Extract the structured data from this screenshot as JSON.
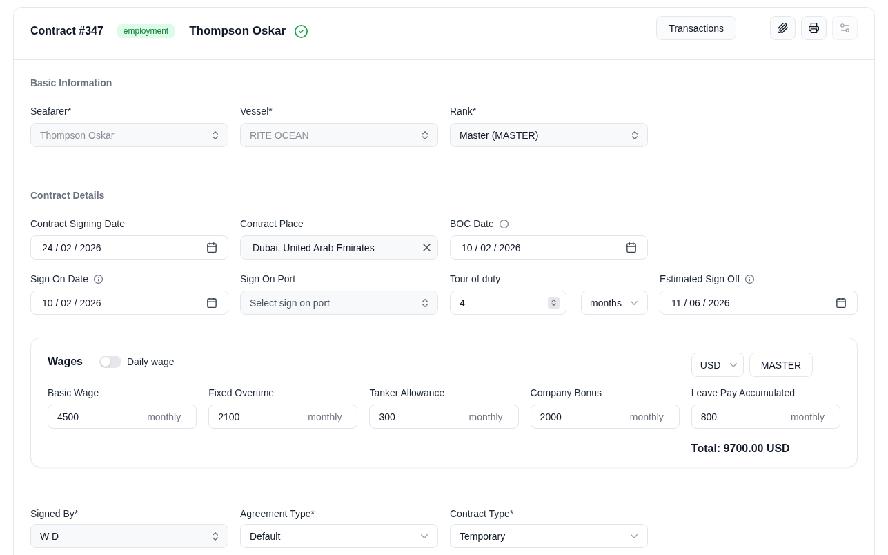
{
  "header": {
    "title": "Contract #347",
    "badge": "employment",
    "seafarer_name": "Thompson Oskar",
    "verified": true,
    "transactions_button": "Transactions",
    "icon_buttons": [
      {
        "kind": "paperclip",
        "disabled": false
      },
      {
        "kind": "printer",
        "disabled": false
      },
      {
        "kind": "sliders",
        "disabled": true
      }
    ]
  },
  "basic_information": {
    "title": "Basic Information",
    "fields": [
      {
        "label": "Seafarer*",
        "kind": "combobox",
        "value": "Thompson Oskar",
        "disabled": true
      },
      {
        "label": "Vessel*",
        "kind": "combobox",
        "value": "RITE OCEAN",
        "disabled": true
      },
      {
        "label": "Rank*",
        "kind": "combobox",
        "value": "Master (MASTER)",
        "disabled": false
      }
    ]
  },
  "contract_details": {
    "title": "Contract Details",
    "rows": [
      [
        {
          "label": "Contract Signing Date",
          "kind": "date",
          "value": "24 / 02 / 2026",
          "info": false
        },
        {
          "label": "Contract Place",
          "kind": "clearable",
          "value": "Dubai, United Arab Emirates",
          "info": false
        },
        {
          "label": "BOC Date",
          "kind": "date",
          "value": "10 / 02 / 2026",
          "info": true
        }
      ],
      [
        {
          "label": "Sign On Date",
          "kind": "date",
          "value": "10 / 02 / 2026",
          "info": true
        },
        {
          "label": "Sign On Port",
          "kind": "combobox",
          "placeholder": "Select sign on port",
          "info": false
        },
        {
          "label": "Tour of duty",
          "kind": "duration",
          "value": "4",
          "unit": "months",
          "info": false
        },
        {
          "label": "Estimated Sign Off",
          "kind": "date",
          "value": "11 / 06 / 2026",
          "info": true
        }
      ]
    ]
  },
  "wages": {
    "title": "Wages",
    "daily_wage": {
      "label": "Daily wage",
      "on": false
    },
    "currency": "USD",
    "rank_button": "MASTER",
    "fields": [
      {
        "label": "Basic Wage",
        "value": "4500",
        "suffix": "monthly"
      },
      {
        "label": "Fixed Overtime",
        "value": "2100",
        "suffix": "monthly"
      },
      {
        "label": "Tanker Allowance",
        "value": "300",
        "suffix": "monthly"
      },
      {
        "label": "Company Bonus",
        "value": "2000",
        "suffix": "monthly"
      },
      {
        "label": "Leave Pay Accumulated",
        "value": "800",
        "suffix": "monthly"
      }
    ],
    "total": "Total: 9700.00 USD"
  },
  "signing": {
    "fields": [
      {
        "label": "Signed By*",
        "kind": "combobox",
        "value": "W D"
      },
      {
        "label": "Agreement Type*",
        "kind": "select",
        "value": "Default"
      },
      {
        "label": "Contract Type*",
        "kind": "select",
        "value": "Temporary"
      }
    ]
  }
}
